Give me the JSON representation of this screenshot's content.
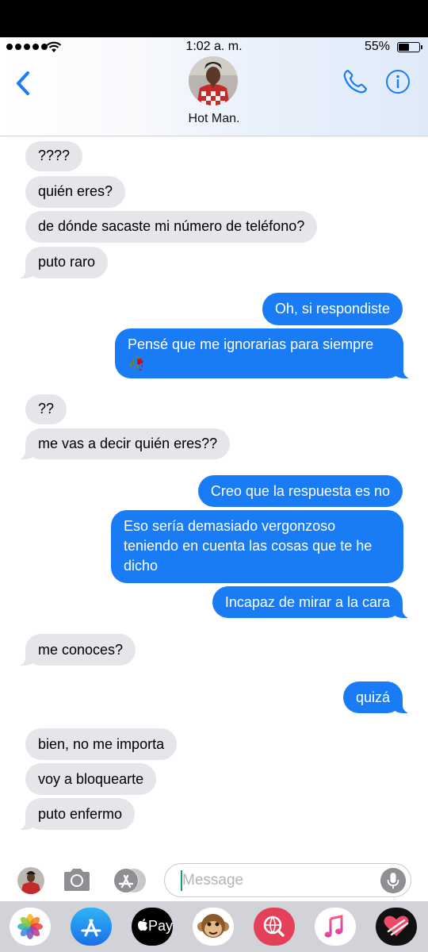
{
  "status_bar": {
    "time": "1:02 a. m.",
    "battery_percent_label": "55%",
    "battery_level": 0.55
  },
  "header": {
    "contact_name": "Hot Man."
  },
  "messages": [
    {
      "from": "them",
      "text": "????"
    },
    {
      "from": "them",
      "text": "quién eres?"
    },
    {
      "from": "them",
      "text": "de dónde sacaste mi número de teléfono?"
    },
    {
      "from": "them",
      "text": "puto raro"
    },
    {
      "from": "me",
      "text": "Oh, si respondiste"
    },
    {
      "from": "me",
      "text": "Pensé que me ignorarias para siempre 🥀"
    },
    {
      "from": "them",
      "text": "??"
    },
    {
      "from": "them",
      "text": "me vas a decir quién eres??"
    },
    {
      "from": "me",
      "text": "Creo que la respuesta es no"
    },
    {
      "from": "me",
      "text": "Eso sería demasiado vergonzoso teniendo en cuenta las cosas que te he dicho"
    },
    {
      "from": "me",
      "text": "Incapaz de mirar a la cara"
    },
    {
      "from": "them",
      "text": "me conoces?"
    },
    {
      "from": "me",
      "text": "quizá"
    },
    {
      "from": "them",
      "text": "bien, no me importa"
    },
    {
      "from": "them",
      "text": "voy a bloquearte"
    },
    {
      "from": "them",
      "text": "puto enfermo"
    }
  ],
  "composer": {
    "placeholder": "Message"
  },
  "app_drawer": {
    "apple_pay_label": "Pay",
    "apps": [
      "photos-app-icon",
      "app-store-icon",
      "apple-pay-icon",
      "animoji-icon",
      "web-images-icon",
      "music-icon",
      "digital-touch-icon"
    ]
  },
  "colors": {
    "outgoing_bubble": "#1a7cf5",
    "incoming_bubble": "#e5e5ea",
    "accent": "#1a7cf5"
  }
}
